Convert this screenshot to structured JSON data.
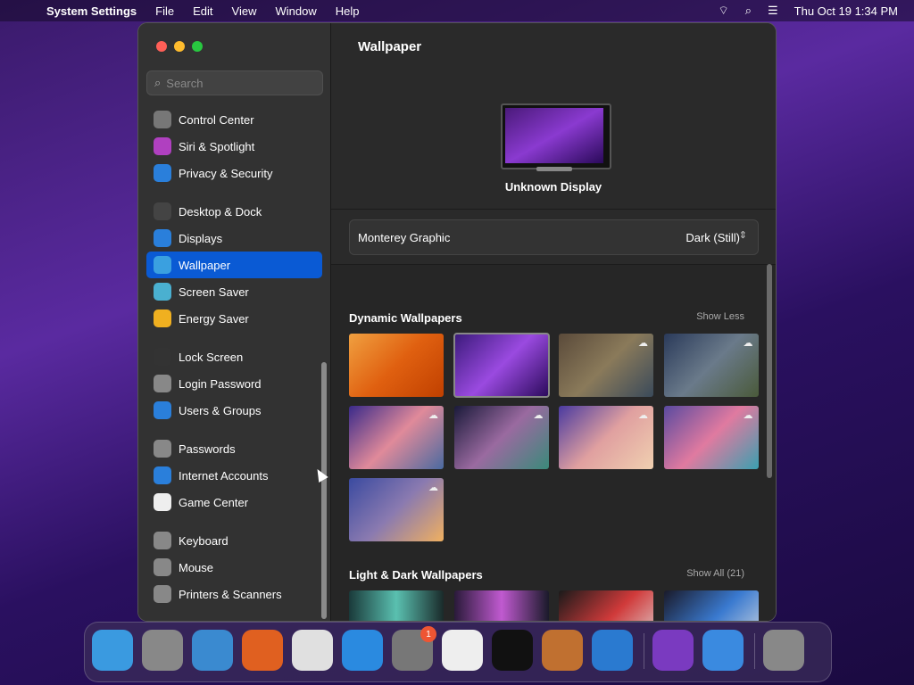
{
  "menubar": {
    "app_name": "System Settings",
    "menus": [
      "File",
      "Edit",
      "View",
      "Window",
      "Help"
    ],
    "datetime": "Thu Oct 19  1:34 PM"
  },
  "sidebar": {
    "search_placeholder": "Search",
    "groups": [
      [
        {
          "label": "Control Center",
          "icon": "control-center-icon",
          "color": "#777"
        },
        {
          "label": "Siri & Spotlight",
          "icon": "siri-icon",
          "color": "#b040c0"
        },
        {
          "label": "Privacy & Security",
          "icon": "hand-icon",
          "color": "#2a7fdb"
        }
      ],
      [
        {
          "label": "Desktop & Dock",
          "icon": "dock-icon",
          "color": "#444"
        },
        {
          "label": "Displays",
          "icon": "sun-icon",
          "color": "#2a7fdb"
        },
        {
          "label": "Wallpaper",
          "icon": "wallpaper-icon",
          "color": "#3aa0e0",
          "selected": true
        },
        {
          "label": "Screen Saver",
          "icon": "screensaver-icon",
          "color": "#4ab0d0"
        },
        {
          "label": "Energy Saver",
          "icon": "bulb-icon",
          "color": "#f0b020"
        }
      ],
      [
        {
          "label": "Lock Screen",
          "icon": "lock-icon",
          "color": "#333"
        },
        {
          "label": "Login Password",
          "icon": "lock-password-icon",
          "color": "#888"
        },
        {
          "label": "Users & Groups",
          "icon": "users-icon",
          "color": "#2a7fdb"
        }
      ],
      [
        {
          "label": "Passwords",
          "icon": "key-icon",
          "color": "#888"
        },
        {
          "label": "Internet Accounts",
          "icon": "at-icon",
          "color": "#2a7fdb"
        },
        {
          "label": "Game Center",
          "icon": "game-center-icon",
          "color": "#eee"
        }
      ],
      [
        {
          "label": "Keyboard",
          "icon": "keyboard-icon",
          "color": "#888"
        },
        {
          "label": "Mouse",
          "icon": "mouse-icon",
          "color": "#888"
        },
        {
          "label": "Printers & Scanners",
          "icon": "printer-icon",
          "color": "#888"
        }
      ]
    ]
  },
  "main": {
    "title": "Wallpaper",
    "display_name": "Unknown Display",
    "wallpaper_name": "Monterey Graphic",
    "appearance_value": "Dark (Still)",
    "sections": [
      {
        "title": "Dynamic Wallpapers",
        "action": "Show Less"
      },
      {
        "title": "Light & Dark Wallpapers",
        "action": "Show All (21)"
      }
    ]
  },
  "dock": {
    "apps": [
      {
        "name": "finder",
        "badge": ""
      },
      {
        "name": "launchpad",
        "badge": ""
      },
      {
        "name": "safari",
        "badge": ""
      },
      {
        "name": "firefox",
        "badge": ""
      },
      {
        "name": "chrome",
        "badge": ""
      },
      {
        "name": "app-store",
        "badge": ""
      },
      {
        "name": "system-settings",
        "badge": "1"
      },
      {
        "name": "textedit",
        "badge": ""
      },
      {
        "name": "terminal",
        "badge": ""
      },
      {
        "name": "garageband",
        "badge": ""
      },
      {
        "name": "vscode",
        "badge": ""
      },
      {
        "name": "visual-studio",
        "badge": ""
      },
      {
        "name": "weather",
        "badge": ""
      },
      {
        "name": "trash",
        "badge": ""
      }
    ]
  },
  "colors": {
    "accent": "#0a5ad4"
  }
}
